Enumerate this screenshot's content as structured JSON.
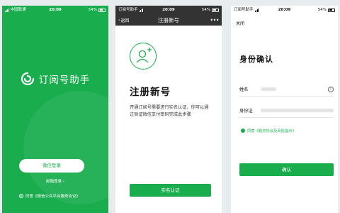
{
  "screens": [
    {
      "status": {
        "carrier": "中国联通",
        "time": "20:08",
        "battery": "54%"
      },
      "app_name": "订阅号助手",
      "wechat_login": "微信登录",
      "email_login": "邮箱登录 ›",
      "agreement": "同意《微信公众平台服务协议》"
    },
    {
      "status": {
        "carrier": "订阅号助手",
        "time": "20:09",
        "battery": "54%"
      },
      "nav": {
        "back": "返回",
        "title": "注册新号",
        "more": "•••"
      },
      "heading": "注册新号",
      "description": "开通订阅号需要进行实名认证，你可以通过验证微信支付密码完成此步骤",
      "verify_button": "实名认证"
    },
    {
      "status": {
        "carrier": "订阅号助手",
        "time": "20:09",
        "battery": "54%"
      },
      "close": "关闭",
      "heading": "身份确认",
      "name_label": "姓名",
      "id_label": "身份证",
      "agreement": "同意《服务协议及风险提示》",
      "confirm_button": "确认"
    }
  ],
  "colors": {
    "brand_green": "#1aad4e",
    "nav_dark": "#333333"
  }
}
